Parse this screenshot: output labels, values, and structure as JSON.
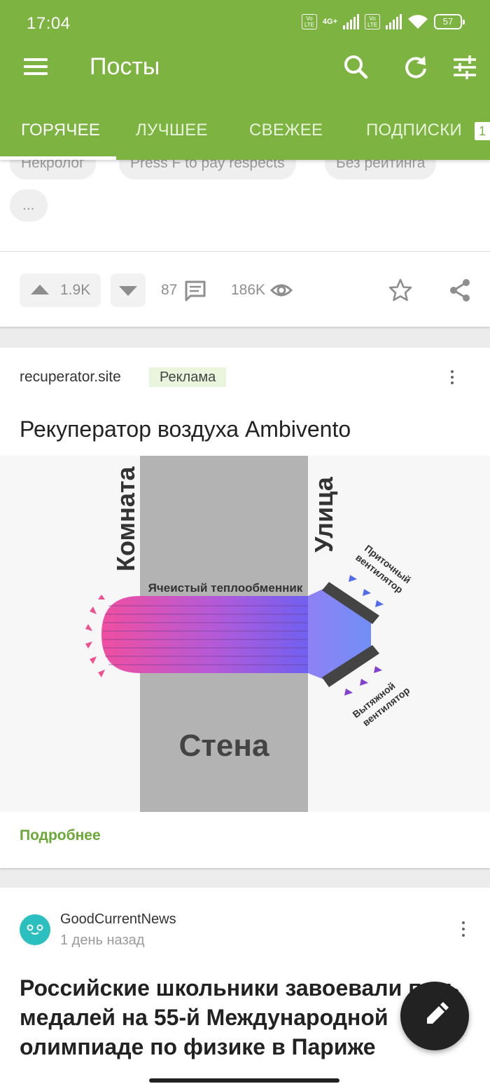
{
  "status_bar": {
    "time": "17:04",
    "net_type": "4G+",
    "volte": "Vo LTE",
    "battery": "57"
  },
  "toolbar": {
    "title": "Посты",
    "icons": [
      "menu-icon",
      "search-icon",
      "refresh-icon",
      "filter-sliders-icon"
    ]
  },
  "tabs": [
    {
      "label": "ГОРЯЧЕЕ",
      "active": true
    },
    {
      "label": "ЛУЧШЕЕ"
    },
    {
      "label": "СВЕЖЕЕ"
    },
    {
      "label": "ПОДПИСКИ"
    }
  ],
  "tabs_badge": "1",
  "tags": [
    "Некролог",
    "Press F to pay respects",
    "Без рейтинга",
    "..."
  ],
  "post_stats": {
    "rating": "1.9K",
    "comments": "87",
    "views": "186K"
  },
  "ad": {
    "site": "recuperator.site",
    "badge": "Реклама",
    "title": "Рекуператор воздуха Ambivento",
    "image": {
      "room": "Комната",
      "street": "Улица",
      "wall": "Стена",
      "exchanger": "Ячеистый теплообменник",
      "supply_fan_1": "Приточный",
      "supply_fan_2": "вентилятор",
      "exhaust_fan_1": "Вытяжной",
      "exhaust_fan_2": "вентилятор"
    },
    "more_link": "Подробнее"
  },
  "next_post": {
    "author": "GoodCurrentNews",
    "time": "1 день назад",
    "title": "Российские школьники завоевали пять медалей на 55-й Международной олимпиаде по физике в Париже"
  },
  "colors": {
    "brand": "#7db340",
    "link": "#6aa838",
    "fab": "#222222"
  }
}
